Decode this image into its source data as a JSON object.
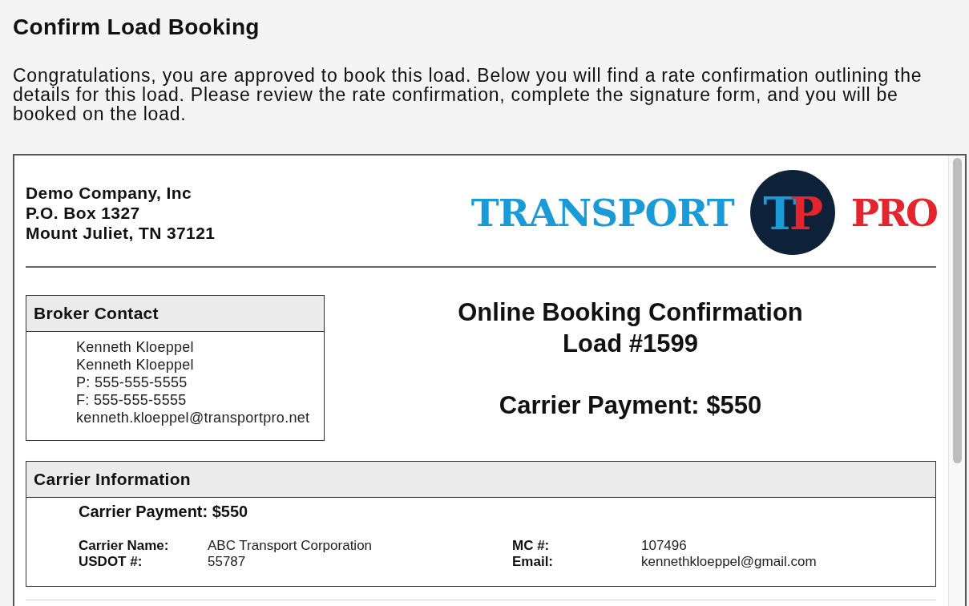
{
  "page": {
    "title": "Confirm Load Booking",
    "intro": "Congratulations, you are approved to book this load. Below you will find a rate confirmation outlining the details for this load. Please review the rate confirmation, complete the signature form, and you will be booked on the load."
  },
  "document": {
    "company_address": [
      "Demo Company, Inc",
      "P.O. Box 1327",
      "Mount Juliet, TN 37121"
    ],
    "logo": {
      "left_text": "TRANSPORT",
      "monogram": [
        {
          "letter": "T",
          "color": "#1a9bd7"
        },
        {
          "letter": "P",
          "color": "#e3262d"
        }
      ],
      "right_text": "PRO"
    },
    "broker_contact": {
      "heading": "Broker Contact",
      "lines": [
        "Kenneth Kloeppel",
        "Kenneth Kloeppel",
        "P: 555-555-5555",
        "F: 555-555-5555",
        "kenneth.kloeppel@transportpro.net"
      ]
    },
    "confirmation": {
      "title": "Online Booking Confirmation",
      "load": "Load #1599",
      "payment": "Carrier Payment: $550"
    },
    "carrier_information": {
      "heading": "Carrier Information",
      "payment": "Carrier Payment: $550",
      "fields": [
        {
          "label": "Carrier Name:",
          "value": "ABC Transport Corporation"
        },
        {
          "label": "MC #:",
          "value": "107496"
        },
        {
          "label": "USDOT #:",
          "value": "55787"
        },
        {
          "label": "Email:",
          "value": "kennethkloeppel@gmail.com"
        }
      ]
    }
  }
}
